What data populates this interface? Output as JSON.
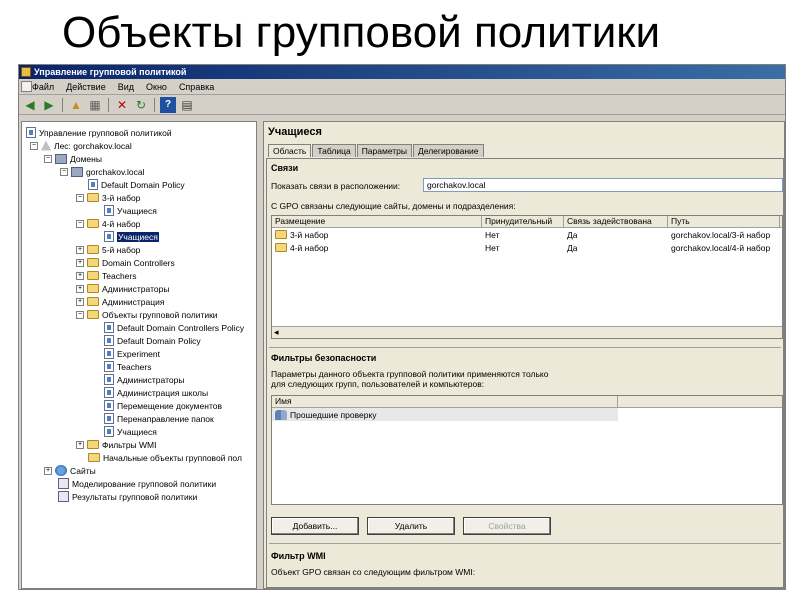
{
  "slide_title": "Объекты групповой политики",
  "window": {
    "title": "Управление групповой политикой"
  },
  "menu": [
    "Файл",
    "Действие",
    "Вид",
    "Окно",
    "Справка"
  ],
  "toolbar": {
    "icons": [
      "back-arrow-icon",
      "forward-arrow-icon",
      "up-folder-icon",
      "show-tree-icon",
      "delete-icon",
      "refresh-icon",
      "help-icon",
      "properties-icon"
    ]
  },
  "tree": [
    "Управление групповой политикой",
    "Лес: gorchakov.local",
    "Домены",
    "gorchakov.local",
    "Default Domain Policy",
    "3-й набор",
    "Учащиеся",
    "4-й набор",
    "Учащиеся",
    "5-й набор",
    "Domain Controllers",
    "Teachers",
    "Администраторы",
    "Администрация",
    "Объекты групповой политики",
    "Default Domain Controllers Policy",
    "Default Domain Policy",
    "Experiment",
    "Teachers",
    "Администраторы",
    "Администрация школы",
    "Перемещение документов",
    "Перенаправление папок",
    "Учащиеся",
    "Фильтры WMI",
    "Начальные объекты групповой пол",
    "Сайты",
    "Моделирование групповой политики",
    "Результаты групповой политики"
  ],
  "right": {
    "title": "Учащиеся",
    "tabs": [
      "Область",
      "Таблица",
      "Параметры",
      "Делегирование"
    ],
    "links_header": "Связи",
    "show_links_label": "Показать связи в расположении:",
    "show_links_value": "gorchakov.local",
    "linked_label": "С GPO связаны следующие сайты, домены и подразделения:",
    "links_columns": [
      "Размещение",
      "Принудительный",
      "Связь задействована",
      "Путь"
    ],
    "links_rows": [
      [
        "3-й набор",
        "Нет",
        "Да",
        "gorchakov.local/3-й набор"
      ],
      [
        "4-й набор",
        "Нет",
        "Да",
        "gorchakov.local/4-й набор"
      ]
    ],
    "security_header": "Фильтры безопасности",
    "security_text_1": "Параметры данного объекта групповой политики применяются только",
    "security_text_2": "для следующих групп, пользователей и компьютеров:",
    "security_column": "Имя",
    "security_rows": [
      "Прошедшие проверку"
    ],
    "buttons": [
      "Добавить...",
      "Удалить",
      "Свойства"
    ],
    "wmi_header": "Фильтр WMI",
    "wmi_text": "Объект GPO связан со следующим фильтром WMI:"
  }
}
